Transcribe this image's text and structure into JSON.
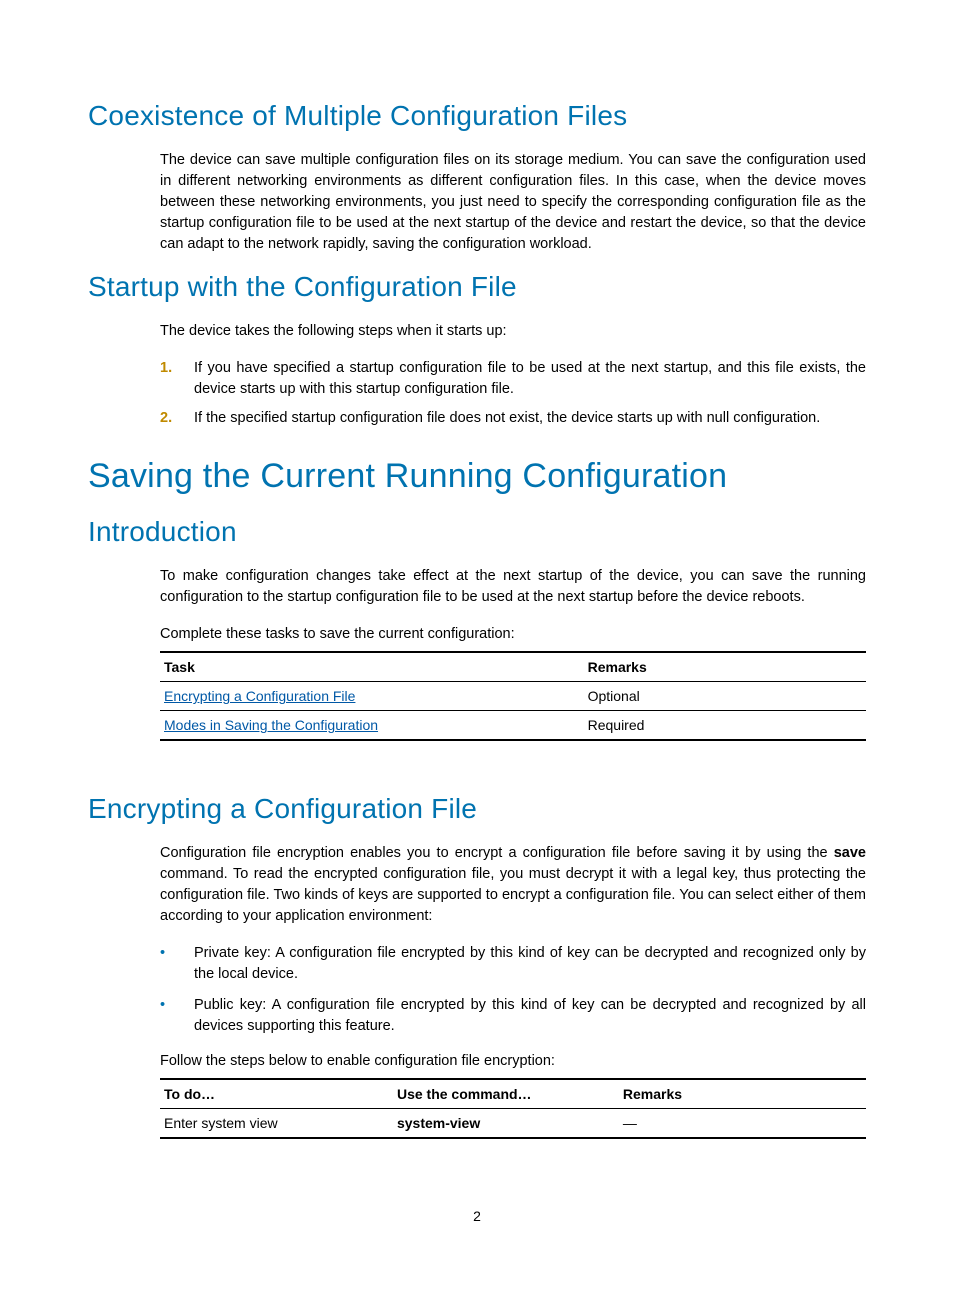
{
  "sections": {
    "coexistence": {
      "heading": "Coexistence of Multiple Configuration Files",
      "para": "The device can save multiple configuration files on its storage medium. You can save the configuration used in different networking environments as different configuration files. In this case, when the device moves between these networking environments, you just need to specify the corresponding configuration file as the startup configuration file to be used at the next startup of the device and restart the device, so that the device can adapt to the network rapidly, saving the configuration workload."
    },
    "startup": {
      "heading": "Startup with the Configuration File",
      "intro": "The device takes the following steps when it starts up:",
      "steps": [
        {
          "num": "1.",
          "text": "If you have specified a startup configuration file to be used at the next startup, and this file exists, the device starts up with this startup configuration file."
        },
        {
          "num": "2.",
          "text": "If the specified startup configuration file does not exist, the device starts up with null configuration."
        }
      ]
    },
    "saving": {
      "heading": "Saving the Current Running Configuration"
    },
    "introduction": {
      "heading": "Introduction",
      "para": "To make configuration changes take effect at the next startup of the device, you can save the running configuration to the startup configuration file to be used at the next startup before the device reboots.",
      "table_intro": "Complete these tasks to save the current configuration:",
      "table": {
        "headers": {
          "task": "Task",
          "remarks": "Remarks"
        },
        "rows": [
          {
            "task": "Encrypting a Configuration File",
            "remarks": "Optional"
          },
          {
            "task": "Modes in Saving the Configuration",
            "remarks": "Required"
          }
        ]
      }
    },
    "encrypting": {
      "heading": "Encrypting a Configuration File",
      "para_pre": "Configuration file encryption enables you to encrypt a configuration file before saving it by using the ",
      "para_bold": "save",
      "para_post": " command. To read the encrypted configuration file, you must decrypt it with a legal key, thus protecting the configuration file. Two kinds of keys are supported to encrypt a configuration file. You can select either of them according to your application environment:",
      "bullets": [
        "Private key: A configuration file encrypted by this kind of key can be decrypted and recognized only by the local device.",
        "Public key: A configuration file encrypted by this kind of key can be decrypted and recognized by all devices supporting this feature."
      ],
      "table_intro": "Follow the steps below to enable configuration file encryption:",
      "table": {
        "headers": {
          "todo": "To do…",
          "cmd": "Use the command…",
          "remarks": "Remarks"
        },
        "rows": [
          {
            "todo": "Enter system view",
            "cmd": "system-view",
            "remarks": "—"
          }
        ]
      }
    }
  },
  "page_number": "2"
}
